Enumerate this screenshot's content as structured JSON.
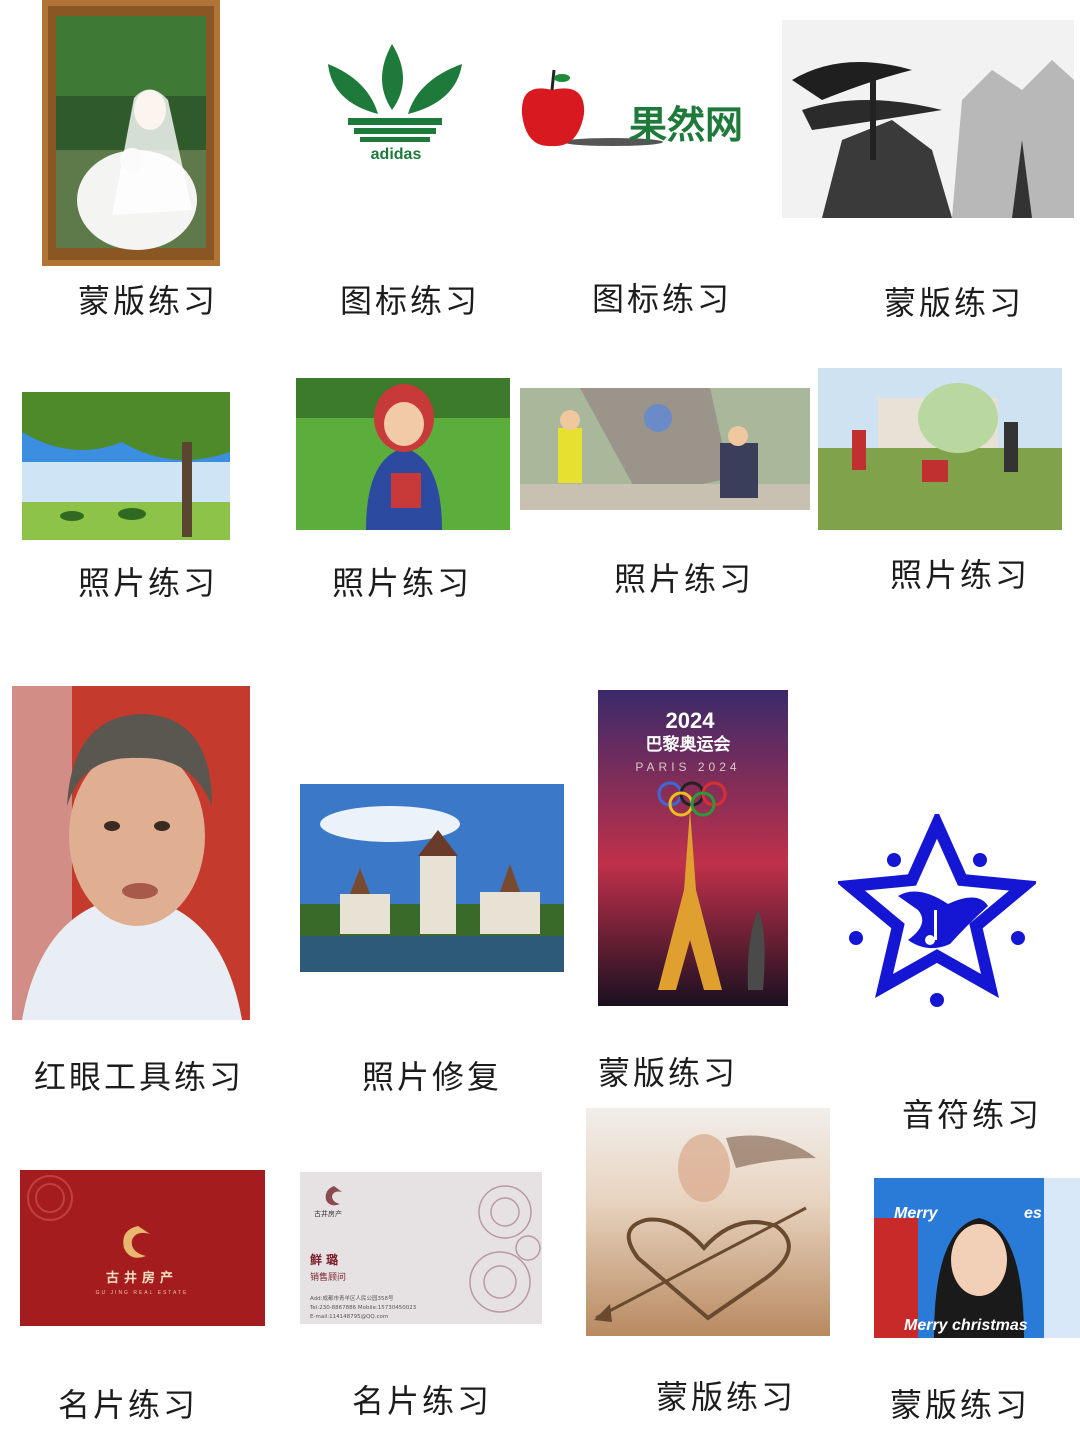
{
  "captions": [
    "蒙版练习",
    "图标练习",
    "图标练习",
    "蒙版练习",
    "照片练习",
    "照片练习",
    "照片练习",
    "照片练习",
    "红眼工具练习",
    "照片修复",
    "蒙版练习",
    "音符练习",
    "名片练习",
    "名片练习",
    "蒙版练习",
    "蒙版练习"
  ],
  "logos": {
    "adidas": "adidas",
    "guoran": "果然网"
  },
  "olympics": {
    "year": "2024",
    "title": "巴黎奥运会",
    "subtitle": "PARIS 2024"
  },
  "card_red": {
    "company": "古井房产",
    "company_en": "GU JING REAL ESTATE"
  },
  "card_white": {
    "company": "古井房产",
    "name": "鲜 璐",
    "title": "销售顾问",
    "address": "Add:成都市青羊区人民公园358号",
    "phone": "Tel:230-8867886   Mobile:15730450023",
    "email": "E-mail:114148795@QQ.com"
  },
  "xmas": {
    "top": "Merry",
    "top_right": "es",
    "bottom": "Merry christmas"
  },
  "colors": {
    "adidas_green": "#1e7a3a",
    "apple_red": "#d8191f",
    "music_blue": "#1515d4",
    "card_red": "#a51c1e"
  }
}
